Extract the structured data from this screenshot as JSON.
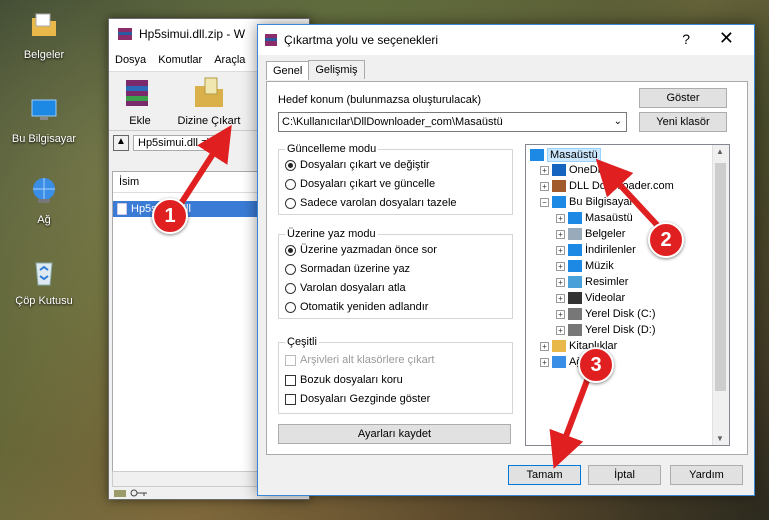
{
  "desktop": {
    "icons": [
      {
        "label": "Belgeler",
        "icon": "documents-folder-icon"
      },
      {
        "label": "Bu Bilgisayar",
        "icon": "computer-icon"
      },
      {
        "label": "Ağ",
        "icon": "network-icon"
      },
      {
        "label": "Çöp Kutusu",
        "icon": "recycle-bin-icon"
      }
    ]
  },
  "winrar": {
    "title": "Hp5simui.dll.zip - W",
    "menu": [
      "Dosya",
      "Komutlar",
      "Araçla"
    ],
    "toolbar": {
      "add_label": "Ekle",
      "extract_label": "Dizine Çıkart"
    },
    "address": "Hp5simui.dll.zip",
    "column_name": "İsim",
    "file_name": "Hp5simui.dll"
  },
  "dialog": {
    "title": "Çıkartma yolu ve seçenekleri",
    "help_glyph": "?",
    "close_glyph": "✕",
    "tabs": [
      "Genel",
      "Gelişmiş"
    ],
    "dest_label": "Hedef konum (bulunmazsa oluşturulacak)",
    "dest_value": "C:\\Kullanıcılar\\DllDownloader_com\\Masaüstü",
    "show_button": "Göster",
    "new_folder_button": "Yeni klasör",
    "update_mode": {
      "title": "Güncelleme modu",
      "options": [
        "Dosyaları çıkart ve değiştir",
        "Dosyaları çıkart ve güncelle",
        "Sadece varolan dosyaları tazele"
      ],
      "selected": 0
    },
    "overwrite_mode": {
      "title": "Üzerine yaz modu",
      "options": [
        "Üzerine yazmadan önce sor",
        "Sormadan üzerine yaz",
        "Varolan dosyaları atla",
        "Otomatik yeniden adlandır"
      ],
      "selected": 0
    },
    "misc": {
      "title": "Çeşitli",
      "options": [
        {
          "label": "Arşivleri alt klasörlere çıkart",
          "checked": false,
          "disabled": true
        },
        {
          "label": "Bozuk dosyaları koru",
          "checked": false,
          "disabled": false
        },
        {
          "label": "Dosyaları Gezginde göster",
          "checked": false,
          "disabled": false
        }
      ]
    },
    "save_settings_button": "Ayarları kaydet",
    "tree": [
      {
        "label": "Masaüstü",
        "level": 0,
        "expander": "",
        "selected": true,
        "icon": "desktop-icon"
      },
      {
        "label": "OneDrive",
        "level": 1,
        "expander": "+",
        "selected": false,
        "icon": "cloud-icon"
      },
      {
        "label": "DLL Downloader.com",
        "level": 1,
        "expander": "+",
        "selected": false,
        "icon": "user-icon"
      },
      {
        "label": "Bu Bilgisayar",
        "level": 1,
        "expander": "−",
        "selected": false,
        "icon": "computer-icon"
      },
      {
        "label": "Masaüstü",
        "level": 2,
        "expander": "+",
        "selected": false,
        "icon": "desktop-icon"
      },
      {
        "label": "Belgeler",
        "level": 2,
        "expander": "+",
        "selected": false,
        "icon": "documents-icon"
      },
      {
        "label": "İndirilenler",
        "level": 2,
        "expander": "+",
        "selected": false,
        "icon": "download-icon"
      },
      {
        "label": "Müzik",
        "level": 2,
        "expander": "+",
        "selected": false,
        "icon": "music-icon"
      },
      {
        "label": "Resimler",
        "level": 2,
        "expander": "+",
        "selected": false,
        "icon": "pictures-icon"
      },
      {
        "label": "Videolar",
        "level": 2,
        "expander": "+",
        "selected": false,
        "icon": "videos-icon"
      },
      {
        "label": "Yerel Disk (C:)",
        "level": 2,
        "expander": "+",
        "selected": false,
        "icon": "disk-icon"
      },
      {
        "label": "Yerel Disk (D:)",
        "level": 2,
        "expander": "+",
        "selected": false,
        "icon": "disk-icon"
      },
      {
        "label": "Kitaplıklar",
        "level": 1,
        "expander": "+",
        "selected": false,
        "icon": "libraries-icon"
      },
      {
        "label": "Ağ",
        "level": 1,
        "expander": "+",
        "selected": false,
        "icon": "network-icon"
      }
    ],
    "ok_button": "Tamam",
    "cancel_button": "İptal",
    "help_button": "Yardım"
  },
  "annotations": {
    "steps": [
      "1",
      "2",
      "3"
    ],
    "color": "#e02020"
  }
}
